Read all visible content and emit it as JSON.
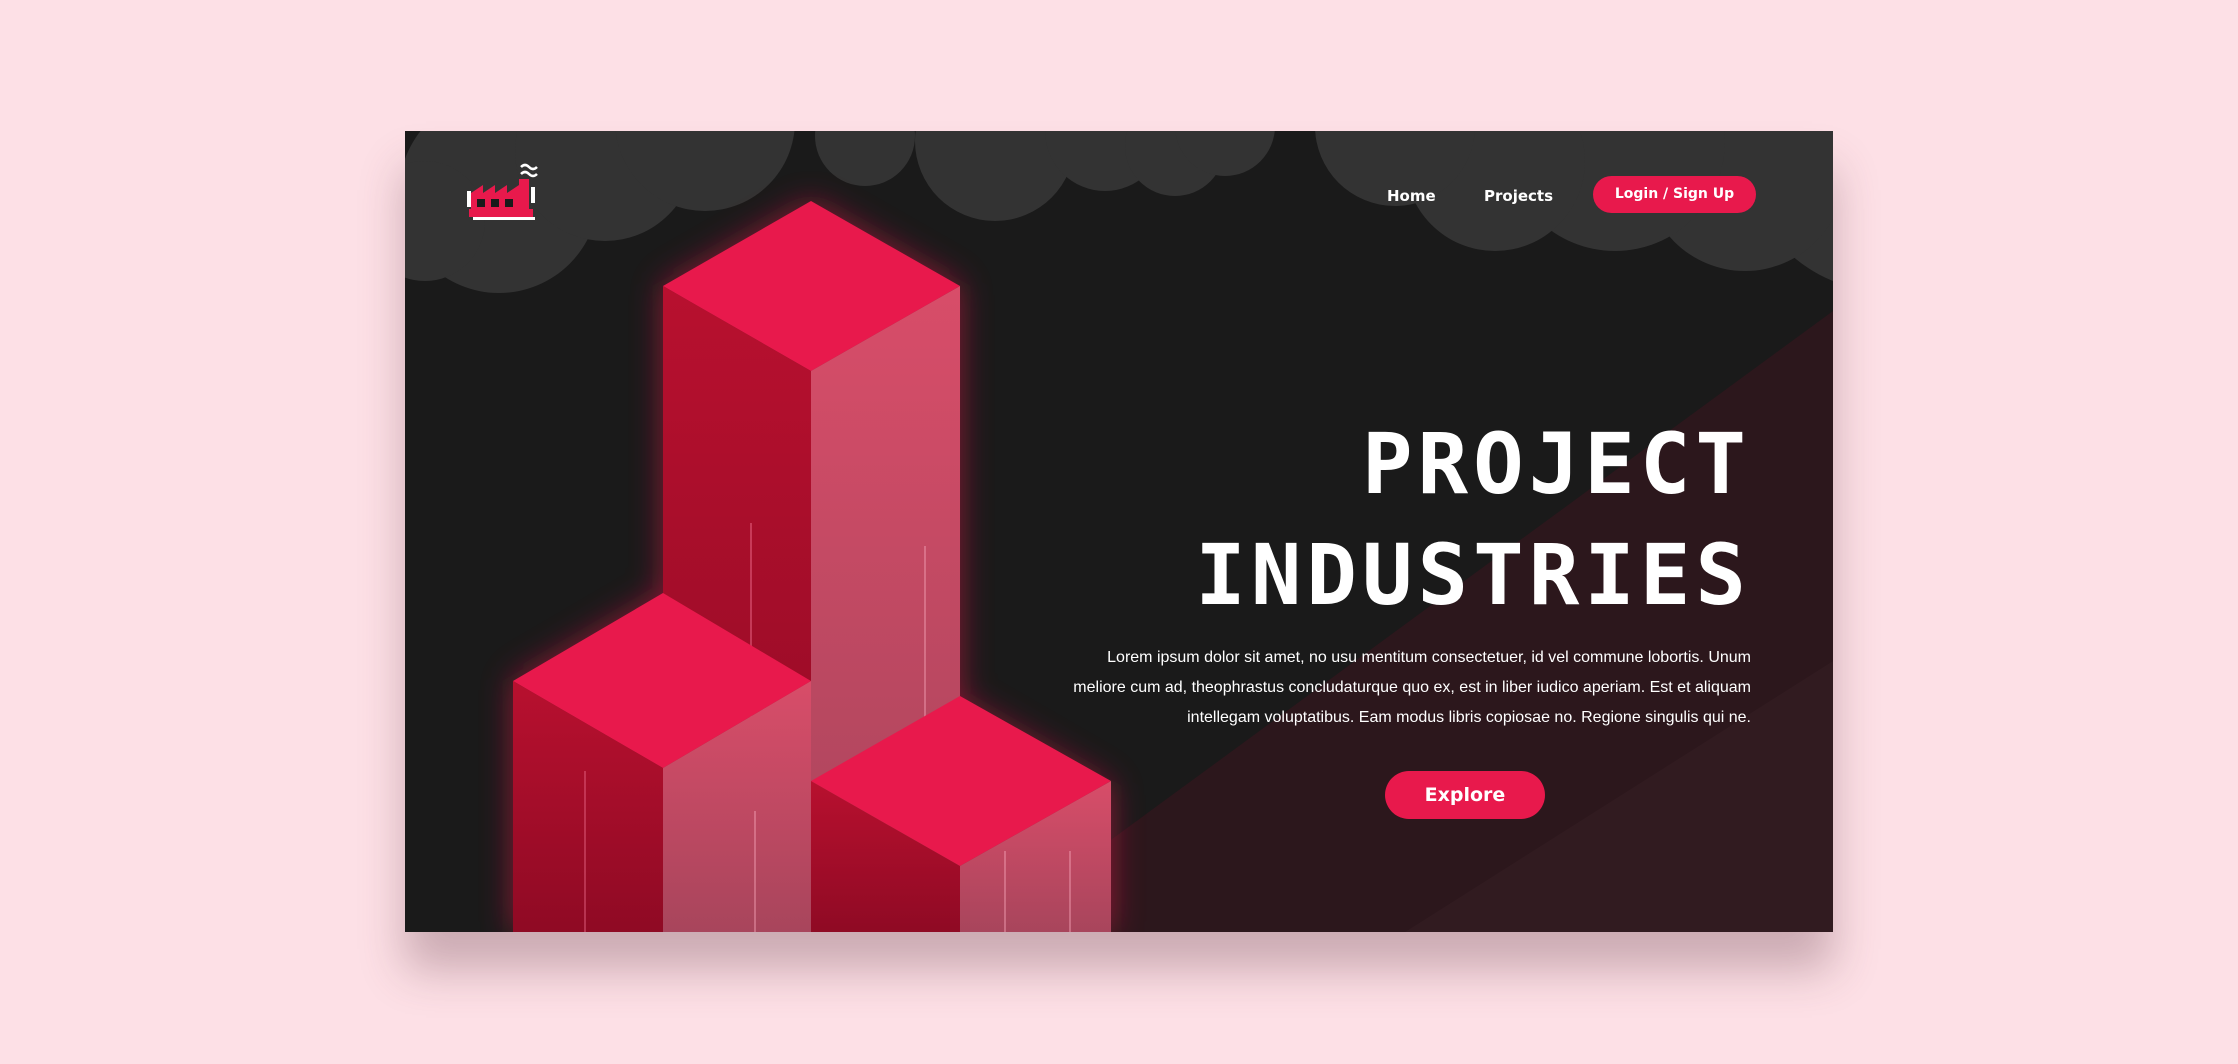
{
  "nav": {
    "home_label": "Home",
    "projects_label": "Projects",
    "login_label": "Login / Sign Up"
  },
  "hero": {
    "title_line_1": "PROJECT",
    "title_line_2": "INDUSTRIES",
    "description": "Lorem ipsum dolor sit amet, no usu mentitum consectetuer, id vel commune  lobortis. Unum meliore cum ad, theophrastus concludaturque quo ex, est in  liber iudico aperiam. Est et aliquam intellegam voluptatibus. Eam modus  libris copiosae no. Regione singulis qui ne.",
    "explore_label": "Explore"
  },
  "icons": {
    "logo": "factory-logo-icon"
  },
  "colors": {
    "page_background": "#fde0e6",
    "card_background": "#1a1a1a",
    "cloud": "#333333",
    "accent": "#e8194c",
    "text": "#ffffff"
  }
}
